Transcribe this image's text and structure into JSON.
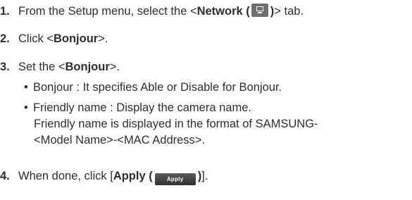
{
  "steps": [
    {
      "number": "1.",
      "prefix": "From the Setup menu, select the <",
      "bold": "Network (",
      "bold_close": ")",
      "suffix": "> tab.",
      "icon": "network-monitor-icon"
    },
    {
      "number": "2.",
      "prefix": "Click <",
      "bold": "Bonjour",
      "suffix": ">."
    },
    {
      "number": "3.",
      "prefix": "Set the <",
      "bold": "Bonjour",
      "suffix": ">.",
      "bullets": [
        {
          "text": "Bonjour : It specifies Able or Disable for Bonjour."
        },
        {
          "text": "Friendly name : Display the camera name.",
          "continuation": [
            "Friendly name is displayed in the format of SAMSUNG-",
            "<Model Name>-<MAC Address>."
          ]
        }
      ]
    },
    {
      "number": "4.",
      "prefix": "When done, click [",
      "bold": "Apply (",
      "bold_close": ")",
      "suffix": "].",
      "button_label": "Apply"
    }
  ]
}
